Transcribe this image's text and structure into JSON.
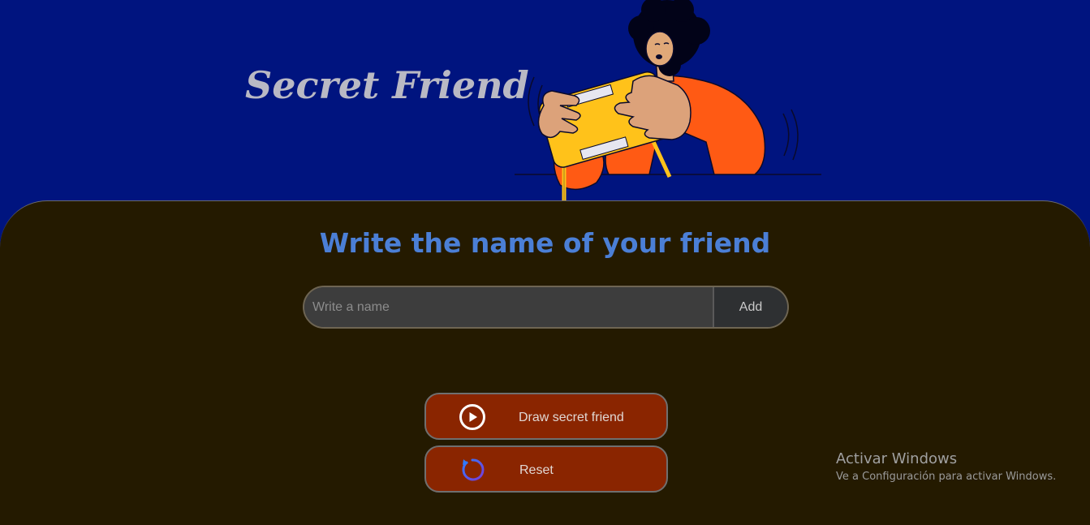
{
  "header": {
    "title": "Secret Friend",
    "background_color": "#00147f",
    "illustration": "person-holding-game-console-illustration"
  },
  "main": {
    "subtitle": "Write the name of your friend",
    "name_input": {
      "value": "",
      "placeholder": "Write a name"
    },
    "add_label": "Add",
    "draw_button": {
      "label": "Draw secret friend",
      "icon": "play-circle-icon"
    },
    "reset_button": {
      "label": "Reset",
      "icon": "reset-icon"
    },
    "panel_color": "#241a00",
    "button_color": "#8a2500",
    "subtitle_color": "#4b7fd6"
  },
  "watermark": {
    "title": "Activar Windows",
    "subtitle": "Ve a Configuración para activar Windows."
  }
}
